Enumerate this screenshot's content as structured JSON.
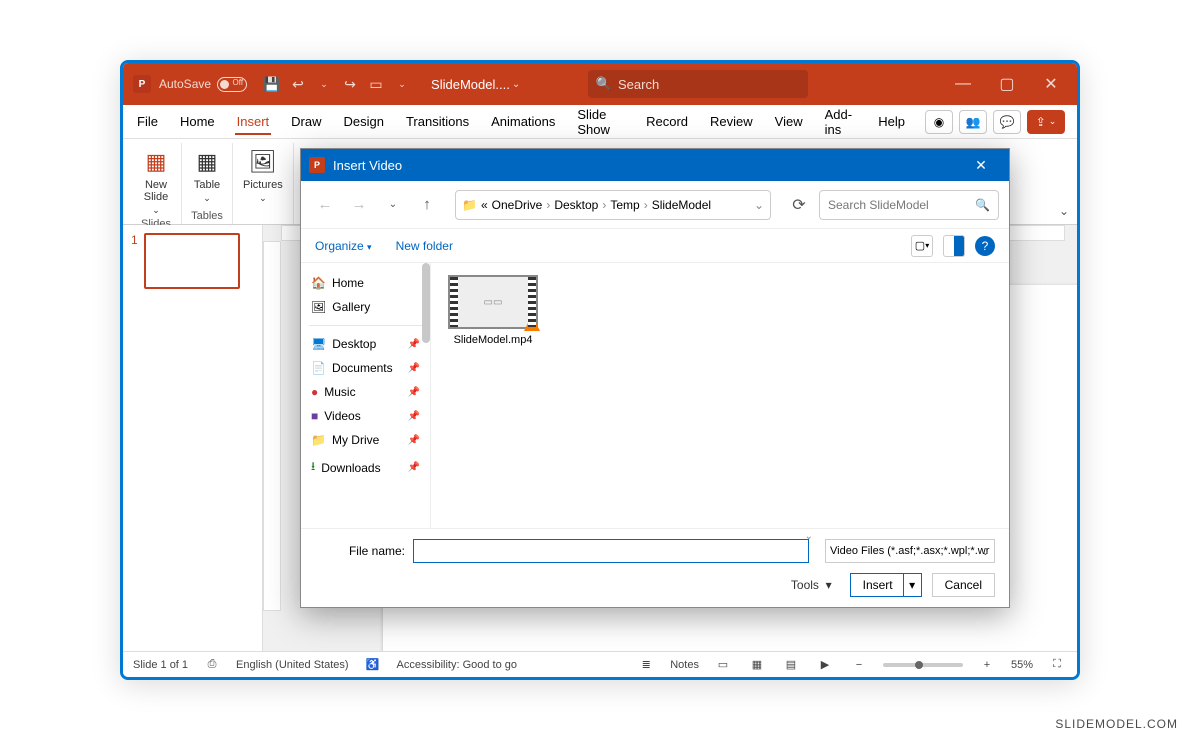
{
  "titlebar": {
    "autosave_label": "AutoSave",
    "autosave_state": "Off",
    "doc_name": "SlideModel....",
    "search_placeholder": "Search"
  },
  "menu": {
    "items": [
      "File",
      "Home",
      "Insert",
      "Draw",
      "Design",
      "Transitions",
      "Animations",
      "Slide Show",
      "Record",
      "Review",
      "View",
      "Add-ins",
      "Help"
    ],
    "active_index": 2
  },
  "ribbon": {
    "groups": [
      {
        "label": "Slides",
        "buttons": [
          {
            "name": "new-slide",
            "text": "New\nSlide",
            "dropdown": true
          }
        ]
      },
      {
        "label": "Tables",
        "buttons": [
          {
            "name": "table",
            "text": "Table",
            "dropdown": true
          }
        ]
      },
      {
        "label": "",
        "buttons": [
          {
            "name": "pictures",
            "text": "Pictures",
            "dropdown": true
          }
        ]
      }
    ]
  },
  "thumbnails": {
    "slides": [
      {
        "num": "1"
      }
    ]
  },
  "dialog": {
    "title": "Insert Video",
    "breadcrumb": [
      "OneDrive",
      "Desktop",
      "Temp",
      "SlideModel"
    ],
    "breadcrumb_prefix": "«",
    "search_placeholder": "Search SlideModel",
    "organize": "Organize",
    "new_folder": "New folder",
    "sidebar_top": [
      {
        "name": "home",
        "label": "Home",
        "icon": "🏠"
      },
      {
        "name": "gallery",
        "label": "Gallery",
        "icon": "🖼"
      }
    ],
    "sidebar_items": [
      {
        "name": "desktop",
        "label": "Desktop",
        "icon": "🖥",
        "color": "#0078d4"
      },
      {
        "name": "documents",
        "label": "Documents",
        "icon": "📄",
        "color": "#5b5b5b"
      },
      {
        "name": "music",
        "label": "Music",
        "icon": "🎵",
        "color": "#d13438"
      },
      {
        "name": "videos",
        "label": "Videos",
        "icon": "🎬",
        "color": "#6b3fa0"
      },
      {
        "name": "mydrive",
        "label": "My Drive",
        "icon": "📁",
        "color": "#e8a33d"
      },
      {
        "name": "downloads",
        "label": "Downloads",
        "icon": "⭳",
        "color": "#107c10"
      }
    ],
    "files": [
      {
        "name": "SlideModel.mp4"
      }
    ],
    "file_name_label": "File name:",
    "file_name_value": "",
    "filter": "Video Files (*.asf;*.asx;*.wpl;*.wr",
    "tools": "Tools",
    "insert": "Insert",
    "cancel": "Cancel"
  },
  "status": {
    "slide": "Slide 1 of 1",
    "language": "English (United States)",
    "accessibility": "Accessibility: Good to go",
    "notes": "Notes",
    "zoom": "55%"
  },
  "watermark": "SLIDEMODEL.COM"
}
